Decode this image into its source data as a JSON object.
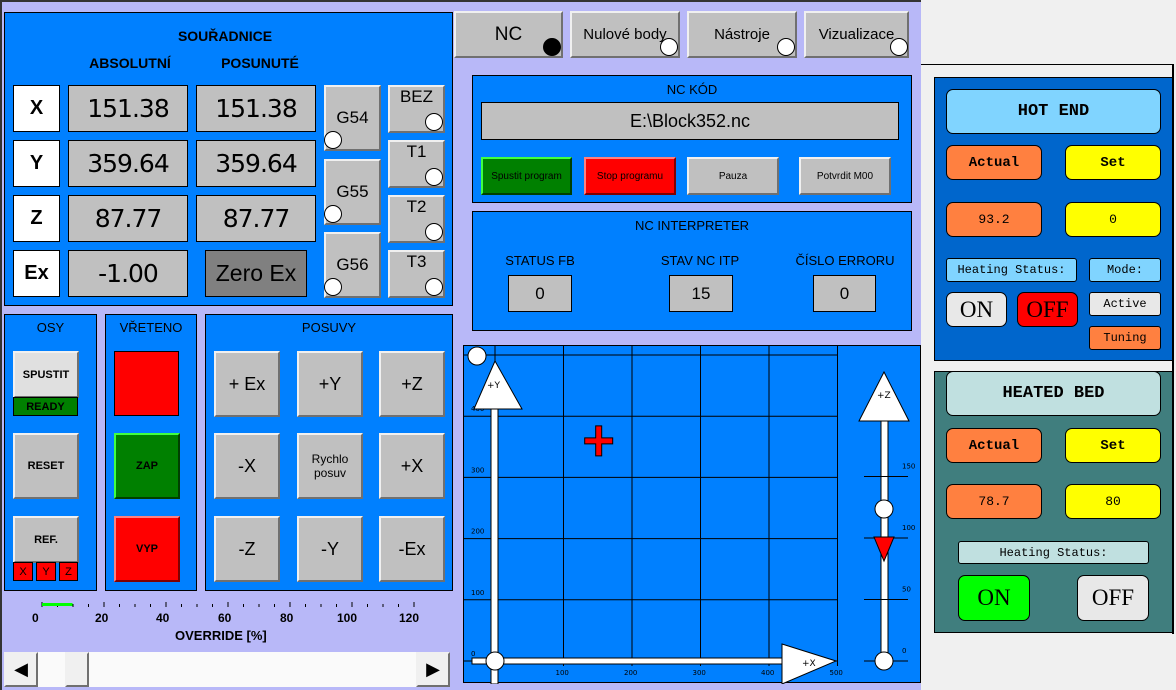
{
  "tabs": [
    {
      "label": "NC",
      "active": true
    },
    {
      "label": "Nulové body",
      "active": false
    },
    {
      "label": "Nástroje",
      "active": false
    },
    {
      "label": "Vizualizace",
      "active": false
    }
  ],
  "coords": {
    "title": "SOUŘADNICE",
    "col_abs": "ABSOLUTNÍ",
    "col_pos": "POSUNUTÉ",
    "rows": [
      {
        "axis": "X",
        "abs": "151.38",
        "pos": "151.38"
      },
      {
        "axis": "Y",
        "abs": "359.64",
        "pos": "359.64"
      },
      {
        "axis": "Z",
        "abs": "87.77",
        "pos": "87.77"
      },
      {
        "axis": "Ex",
        "abs": "-1.00"
      }
    ],
    "zero_ex": "Zero Ex",
    "offsets": [
      "G54",
      "G55",
      "G56"
    ],
    "tools": [
      "BEZ",
      "T1",
      "T2",
      "T3"
    ]
  },
  "nc_code": {
    "title": "NC KÓD",
    "file": "E:\\Block352.nc",
    "start": "Spustit program",
    "stop": "Stop programu",
    "pause": "Pauza",
    "confirm": "Potvrdit M00"
  },
  "interpreter": {
    "title": "NC INTERPRETER",
    "status_fb_label": "STATUS FB",
    "status_fb": "0",
    "stav_label": "STAV NC ITP",
    "stav": "15",
    "error_label": "ČÍSLO ERRORU",
    "error": "0"
  },
  "osy": {
    "title": "OSY",
    "start": "SPUSTIT",
    "ready": "READY",
    "reset": "RESET",
    "ref": "REF.",
    "ref_axes": [
      "X",
      "Y",
      "Z"
    ]
  },
  "vreteno": {
    "title": "VŘETENO",
    "on": "ZAP",
    "off": "VYP"
  },
  "posuvy": {
    "title": "POSUVY",
    "buttons": [
      "+ Ex",
      "+Y",
      "+Z",
      "-X",
      "Rychlo posuv",
      "+X",
      "-Z",
      "-Y",
      "-Ex"
    ]
  },
  "override": {
    "label": "OVERRIDE [%]",
    "ticks": [
      "0",
      "20",
      "40",
      "60",
      "80",
      "100",
      "120"
    ],
    "value_percent": 5
  },
  "visual": {
    "x_ticks": [
      "100",
      "200",
      "300",
      "400",
      "500"
    ],
    "y_ticks": [
      "0",
      "100",
      "200",
      "300",
      "400"
    ],
    "z_ticks": [
      "0",
      "50",
      "100",
      "150"
    ],
    "x_label": "+X",
    "y_label": "+Y",
    "z_label": "+Z",
    "position_x": 151.38,
    "position_y": 359.64,
    "position_z": 87.77
  },
  "hot_end": {
    "title": "HOT END",
    "actual_label": "Actual",
    "set_label": "Set",
    "actual": "93.2",
    "set": "0",
    "heating_status": "Heating Status:",
    "mode": "Mode:",
    "on": "ON",
    "off": "OFF",
    "active": "Active",
    "tuning": "Tuning"
  },
  "heated_bed": {
    "title": "HEATED BED",
    "actual_label": "Actual",
    "set_label": "Set",
    "actual": "78.7",
    "set": "80",
    "heating_status": "Heating Status:",
    "on": "ON",
    "off": "OFF"
  },
  "colors": {
    "panel": "#0080ff",
    "background": "#b8b8f8",
    "hot_end": "#0066cc",
    "heated_bed": "#407e7e",
    "on_green": "#00ff00",
    "off_red": "#ff0000"
  }
}
